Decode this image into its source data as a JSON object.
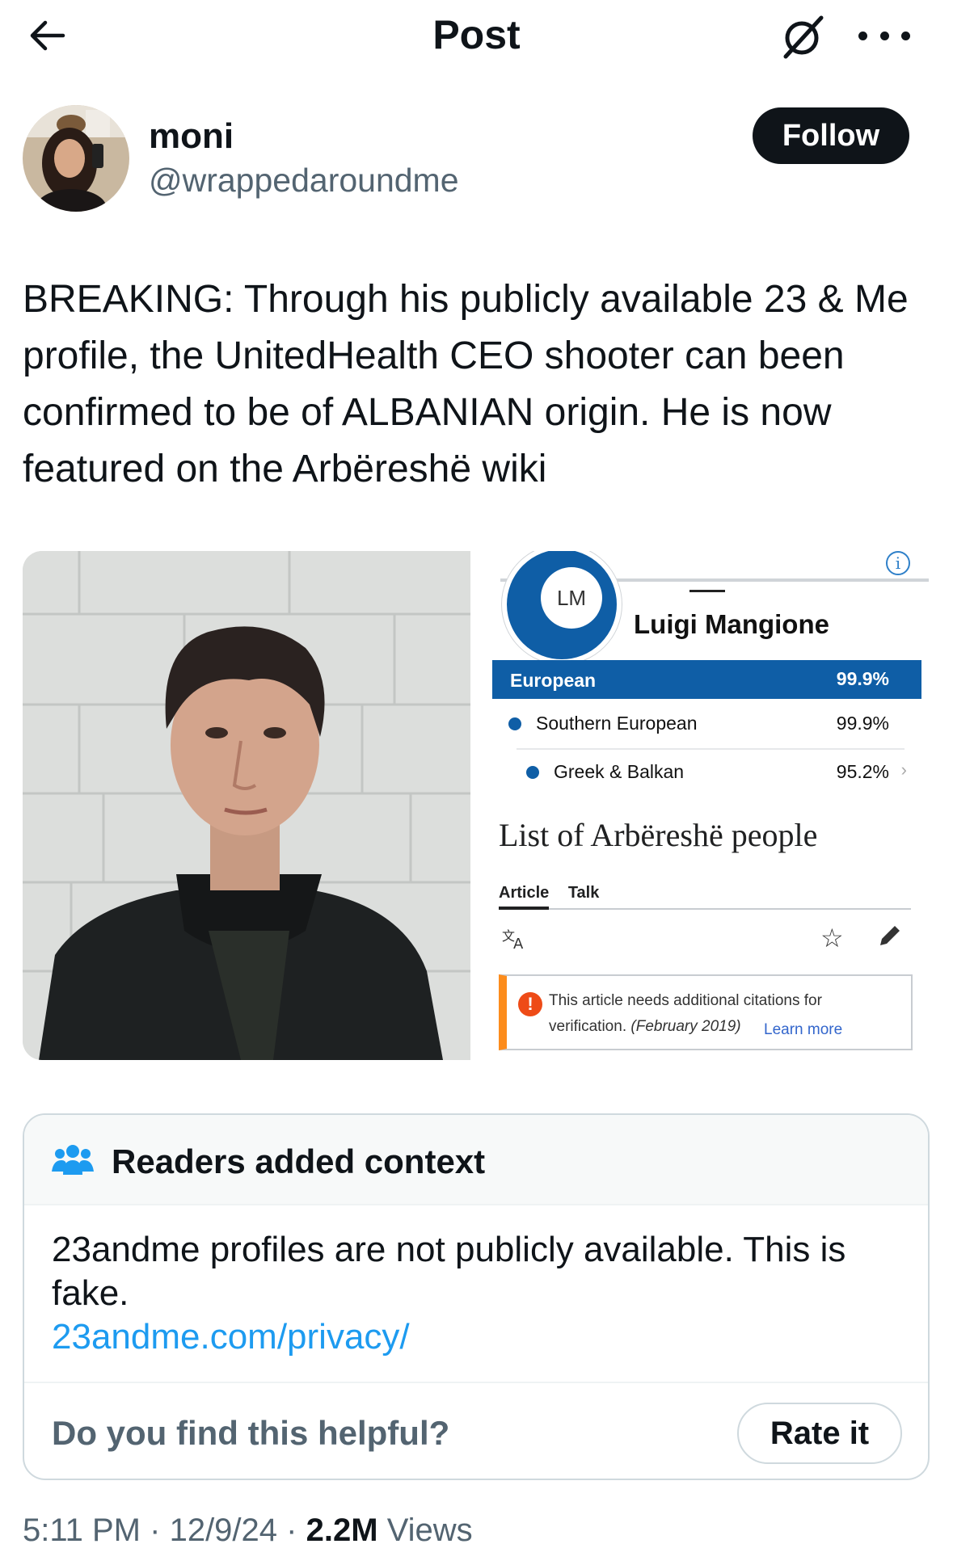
{
  "header": {
    "title": "Post"
  },
  "author": {
    "name": "moni",
    "handle": "@wrappedaroundme",
    "follow_label": "Follow"
  },
  "tweet": {
    "text": "BREAKING: Through his publicly available 23 & Me profile, the UnitedHealth CEO shooter can been confirmed to be of ALBANIAN origin. He is now featured on the Arbëreshë wiki"
  },
  "media": {
    "ancestry": {
      "initials": "LM",
      "name": "Luigi Mangione",
      "info_icon": "i",
      "rows": [
        {
          "label": "European",
          "value": "99.9%"
        },
        {
          "label": "Southern European",
          "value": "99.9%"
        },
        {
          "label": "Greek & Balkan",
          "value": "95.2%"
        }
      ]
    },
    "wiki": {
      "title": "List of Arbëreshë people",
      "tabs": [
        "Article",
        "Talk"
      ],
      "notice_line1": "This article needs additional citations for",
      "notice_line2": "verification.",
      "notice_date": "(February 2019)",
      "learn_more": "Learn more"
    }
  },
  "note": {
    "title": "Readers added context",
    "body": "23andme profiles are not publicly available. This is fake.",
    "link": "23andme.com/privacy/",
    "helpful_prompt": "Do you find this helpful?",
    "rate_label": "Rate it"
  },
  "meta": {
    "time": "5:11 PM",
    "date": "12/9/24",
    "views_count": "2.2M",
    "views_label": "Views",
    "sep": "·"
  },
  "icons": [
    "back-arrow-icon",
    "grok-icon",
    "more-icon",
    "people-icon",
    "translate-icon",
    "star-icon",
    "pencil-icon",
    "warning-icon"
  ]
}
